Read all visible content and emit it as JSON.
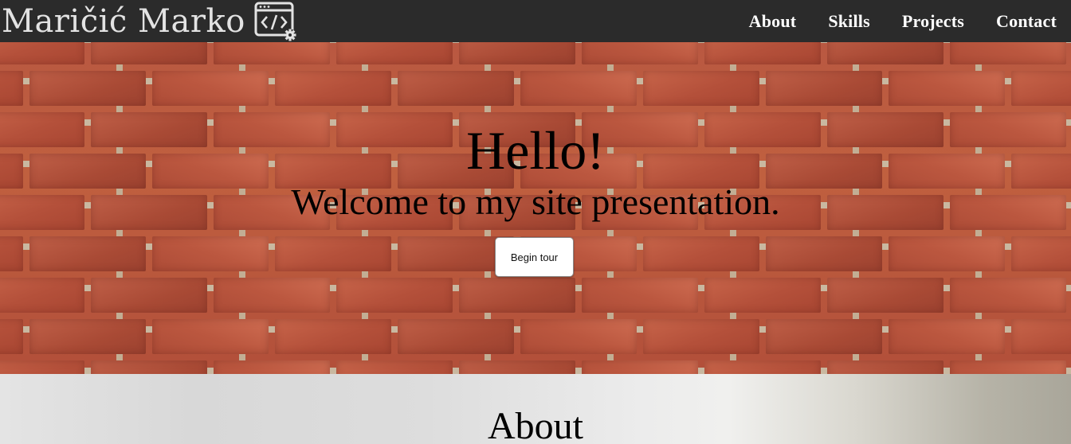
{
  "brand": {
    "name": "Maričić Marko",
    "logo_icon": "code-window-gear-icon"
  },
  "nav": {
    "items": [
      {
        "label": "About"
      },
      {
        "label": "Skills"
      },
      {
        "label": "Projects"
      },
      {
        "label": "Contact"
      }
    ]
  },
  "hero": {
    "title": "Hello!",
    "subtitle": "Welcome to my site presentation.",
    "cta_label": "Begin tour",
    "background": "brick-wall-image"
  },
  "about": {
    "title": "About"
  },
  "colors": {
    "navbar_bg": "#2b2b2b",
    "nav_text": "#ffffff",
    "brand_text": "#e3e3e3",
    "brick": "#b8553e",
    "mortar": "#c9b8a0"
  }
}
